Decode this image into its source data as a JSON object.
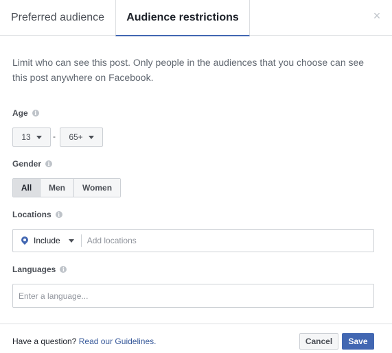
{
  "tabs": [
    {
      "label": "Preferred audience",
      "active": false
    },
    {
      "label": "Audience restrictions",
      "active": true
    }
  ],
  "close_icon": "×",
  "description": "Limit who can see this post. Only people in the audiences that you choose can see this post anywhere on Facebook.",
  "info_icon": "i",
  "age": {
    "label": "Age",
    "min": "13",
    "separator": "-",
    "max": "65+"
  },
  "gender": {
    "label": "Gender",
    "options": [
      "All",
      "Men",
      "Women"
    ],
    "selected": "All"
  },
  "locations": {
    "label": "Locations",
    "include_label": "Include",
    "placeholder": "Add locations"
  },
  "languages": {
    "label": "Languages",
    "placeholder": "Enter a language..."
  },
  "footer": {
    "question": "Have a question?",
    "link": "Read our Guidelines.",
    "cancel": "Cancel",
    "save": "Save"
  },
  "colors": {
    "accent": "#4267b2",
    "link": "#365899"
  }
}
